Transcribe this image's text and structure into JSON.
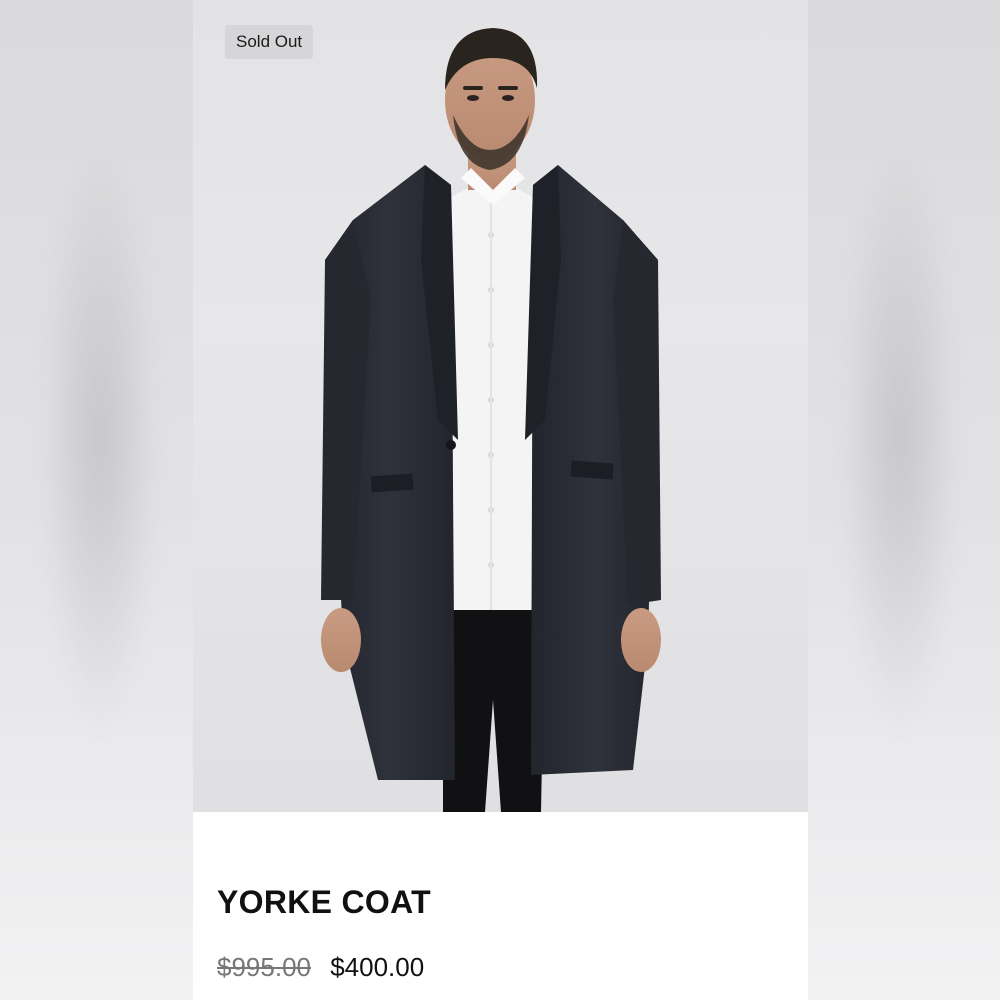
{
  "badge": {
    "label": "Sold Out"
  },
  "product": {
    "title": "YORKE COAT",
    "price_original": "$995.00",
    "price_sale": "$400.00",
    "image": "man-in-long-dark-coat-photo"
  },
  "colors": {
    "coat": "#2b2d36",
    "shirt": "#f4f4f4",
    "background": "#e6e6e8",
    "text": "#111111"
  }
}
